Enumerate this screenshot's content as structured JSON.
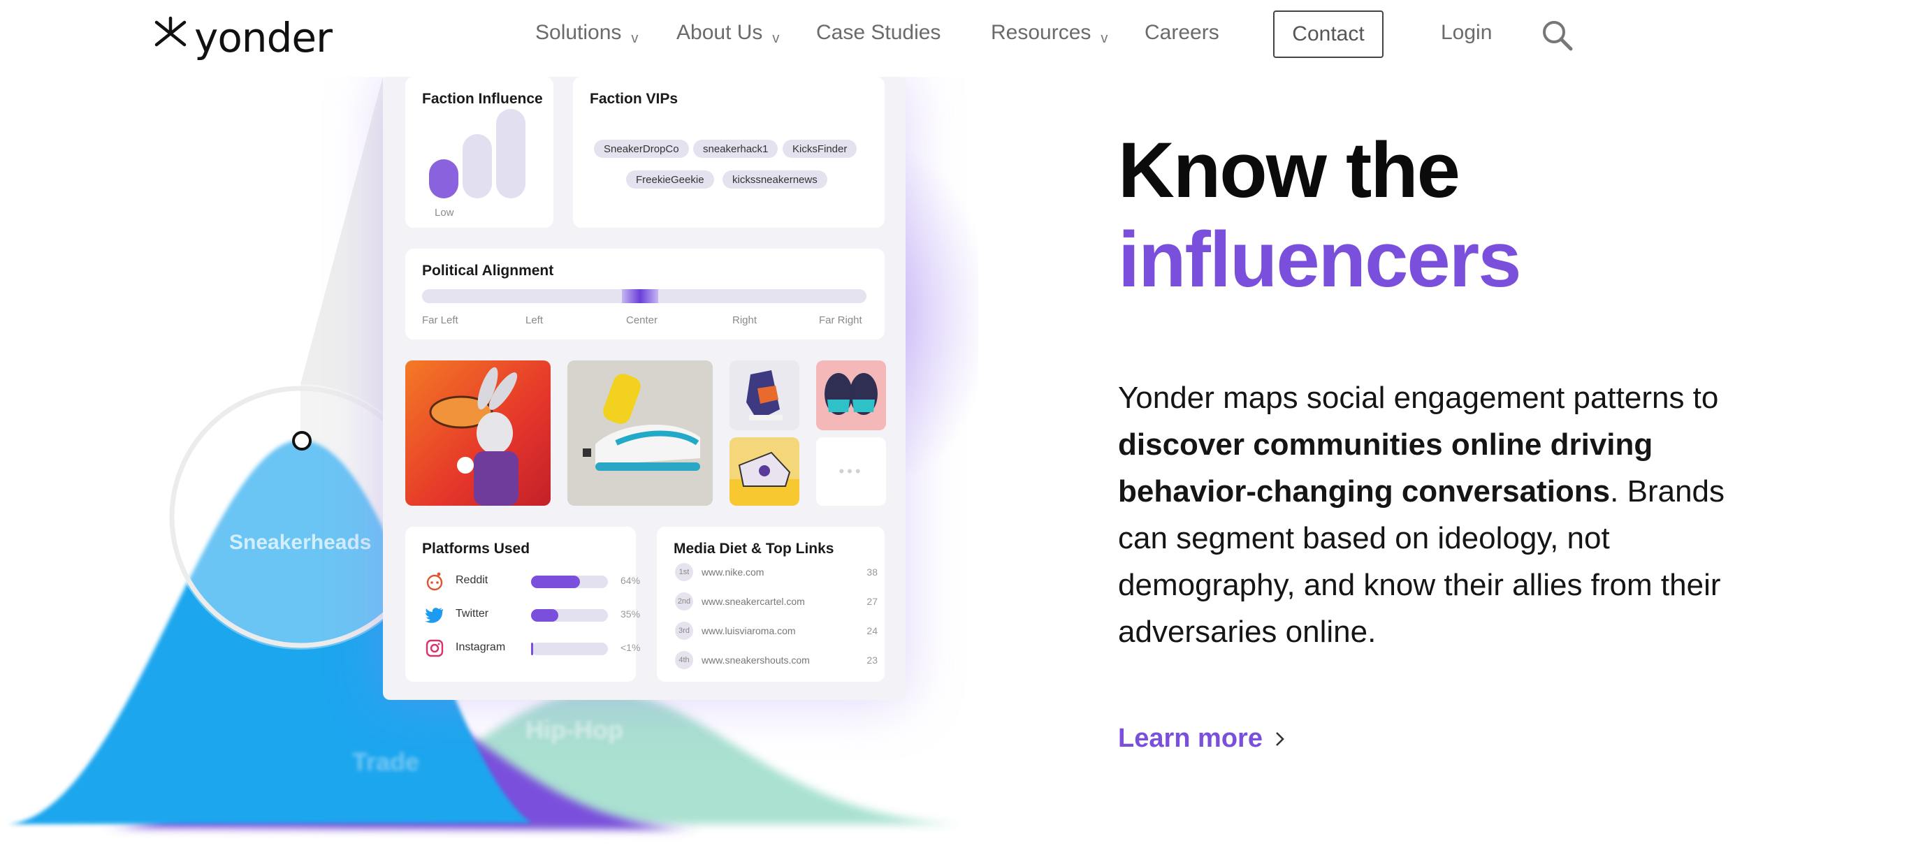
{
  "nav": {
    "logo_text": "yonder",
    "items": [
      {
        "label": "Solutions",
        "has_dropdown": true
      },
      {
        "label": "About Us",
        "has_dropdown": true
      },
      {
        "label": "Case Studies",
        "has_dropdown": false
      },
      {
        "label": "Resources",
        "has_dropdown": true
      },
      {
        "label": "Careers",
        "has_dropdown": false
      }
    ],
    "dropdown_glyph": "v",
    "contact_label": "Contact",
    "login_label": "Login",
    "search_icon": "search-icon"
  },
  "hero": {
    "title_line1": "Know the",
    "title_line2": "influencers",
    "body_intro": "Yonder maps social engagement patterns to ",
    "body_bold": "discover communities online driving behavior-changing conversations",
    "body_rest": ". Brands can segment based on ideology,  not demography, and know their allies from their adversaries online.",
    "cta_label": "Learn more",
    "cta_icon": "chevron-right-icon"
  },
  "dashboard": {
    "faction_influence": {
      "title": "Faction Influence",
      "level_label": "Low",
      "level": 1,
      "levels_total": 3
    },
    "faction_vips": {
      "title": "Faction VIPs",
      "chips": [
        "SneakerDropCo",
        "sneakerhack1",
        "KicksFinder",
        "FreekieGeekie",
        "kickssneakernews"
      ]
    },
    "political_alignment": {
      "title": "Political Alignment",
      "labels": [
        "Far Left",
        "Left",
        "Center",
        "Right",
        "Far Right"
      ],
      "position": 0.5
    },
    "platforms": {
      "title": "Platforms Used",
      "rows": [
        {
          "name": "Reddit",
          "pct_label": "64%",
          "value": 0.64,
          "icon": "reddit-icon"
        },
        {
          "name": "Twitter",
          "pct_label": "35%",
          "value": 0.35,
          "icon": "twitter-icon"
        },
        {
          "name": "Instagram",
          "pct_label": "<1%",
          "value": 0.01,
          "icon": "instagram-icon"
        }
      ]
    },
    "media_diet": {
      "title": "Media Diet & Top Links",
      "rows": [
        {
          "rank": "1st",
          "url": "www.nike.com",
          "value": "38"
        },
        {
          "rank": "2nd",
          "url": "www.sneakercartel.com",
          "value": "27"
        },
        {
          "rank": "3rd",
          "url": "www.luisviaroma.com",
          "value": "24"
        },
        {
          "rank": "4th",
          "url": "www.sneakershouts.com",
          "value": "23"
        }
      ]
    },
    "more_glyph": "•••"
  },
  "segments": {
    "primary": "Sneakerheads",
    "secondary": "Trade",
    "tertiary": "Hip-Hop"
  },
  "colors": {
    "accent": "#7a4fdc",
    "segment_blue": "#1ea6ee",
    "segment_purple": "#7a4fdc",
    "segment_mint": "#a6e0cf"
  }
}
